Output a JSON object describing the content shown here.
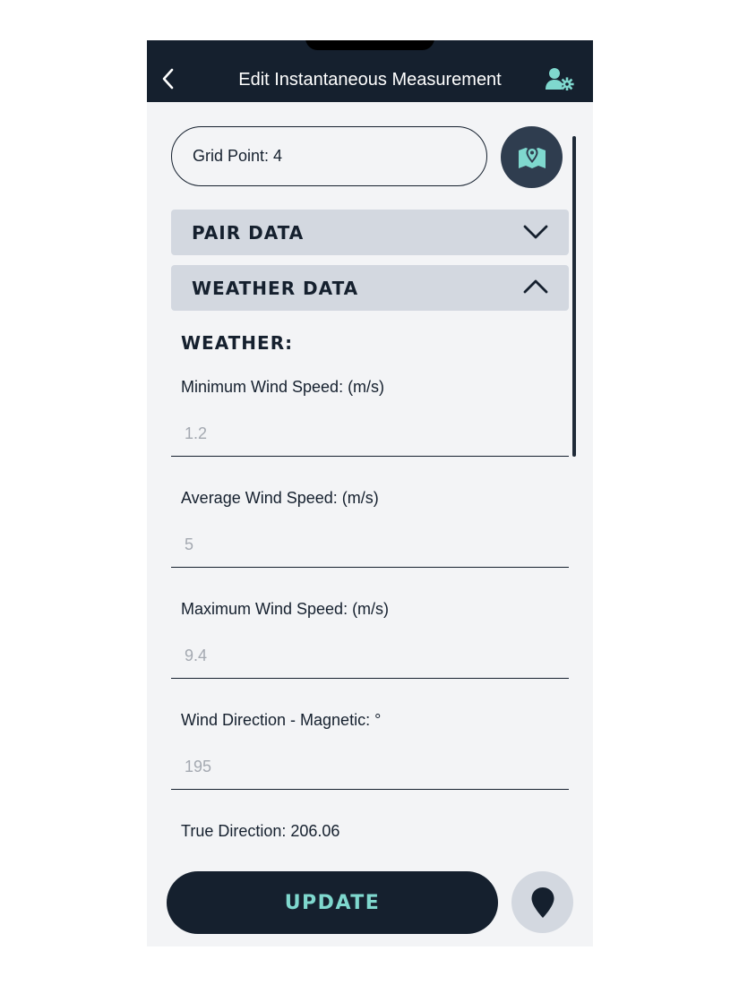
{
  "header": {
    "title": "Edit Instantaneous Measurement",
    "back_icon": "chevron-left-icon",
    "settings_icon": "user-settings-icon"
  },
  "grid_point": {
    "label": "Grid Point: 4",
    "map_icon": "map-pin-icon"
  },
  "sections": {
    "pair_data": {
      "label": "PAIR DATA",
      "expanded": false
    },
    "weather_data": {
      "label": "WEATHER DATA",
      "expanded": true
    }
  },
  "weather": {
    "heading": "WEATHER:",
    "fields": [
      {
        "label": "Minimum Wind Speed: (m/s)",
        "placeholder": "1.2"
      },
      {
        "label": "Average Wind Speed: (m/s)",
        "placeholder": "5"
      },
      {
        "label": "Maximum Wind Speed: (m/s)",
        "placeholder": "9.4"
      },
      {
        "label": "Wind Direction - Magnetic: °",
        "placeholder": "195"
      }
    ],
    "true_direction": "True Direction: 206.06"
  },
  "actions": {
    "update_label": "UPDATE",
    "pin_icon": "location-pin-icon"
  },
  "colors": {
    "header_bg": "#15202e",
    "accent": "#7fd8ce",
    "accordion_bg": "#d3d8e0",
    "page_bg": "#f3f4f6"
  }
}
